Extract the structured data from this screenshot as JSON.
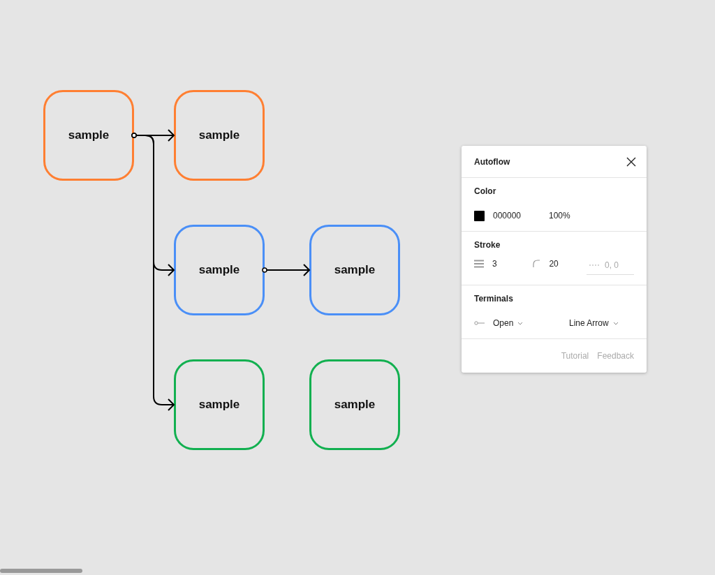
{
  "canvas": {
    "rows": [
      [
        {
          "label": "sample",
          "color": "#ff7f32",
          "arrow_out": true,
          "arrow_in": false
        },
        {
          "label": "sample",
          "color": "#ff7f32",
          "arrow_out": false,
          "arrow_in": true
        },
        null
      ],
      [
        null,
        {
          "label": "sample",
          "color": "#4a8ff7",
          "arrow_out": true,
          "arrow_in": true
        },
        {
          "label": "sample",
          "color": "#4a8ff7",
          "arrow_out": false,
          "arrow_in": true
        }
      ],
      [
        null,
        {
          "label": "sample",
          "color": "#12b050",
          "arrow_out": false,
          "arrow_in": true
        },
        {
          "label": "sample",
          "color": "#12b050",
          "arrow_out": false,
          "arrow_in": false
        }
      ]
    ]
  },
  "panel": {
    "title": "Autoflow",
    "color": {
      "label": "Color",
      "hex": "000000",
      "opacity": "100%"
    },
    "stroke": {
      "label": "Stroke",
      "weight": "3",
      "radius": "20",
      "dash_placeholder": "0, 0"
    },
    "terminals": {
      "label": "Terminals",
      "start": "Open",
      "end": "Line Arrow"
    },
    "links": [
      "Tutorial",
      "Feedback"
    ]
  }
}
